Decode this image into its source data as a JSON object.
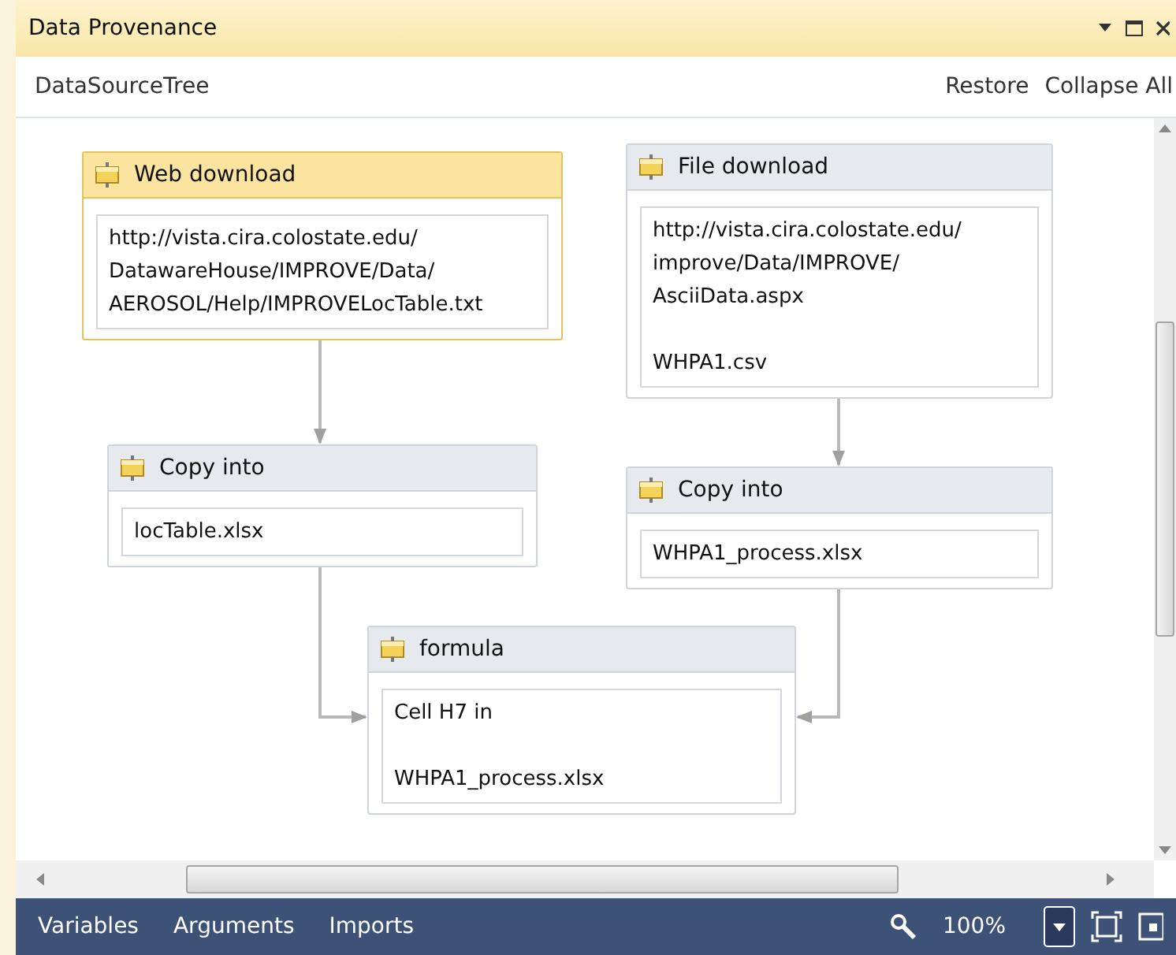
{
  "window": {
    "title": "Data Provenance"
  },
  "toolbar": {
    "title": "DataSourceTree",
    "actions": [
      "Restore",
      "Collapse All"
    ]
  },
  "nodes": [
    {
      "title": "Web download",
      "value": "http://vista.cira.colostate.edu/\nDatawareHouse/IMPROVE/Data/\nAEROSOL/Help/IMPROVELocTable.txt",
      "selected": true
    },
    {
      "title": "File download",
      "value": "http://vista.cira.colostate.edu/\nimprove/Data/IMPROVE/\nAsciiData.aspx\n\nWHPA1.csv",
      "selected": false
    },
    {
      "title": "Copy into",
      "value": "locTable.xlsx",
      "selected": false
    },
    {
      "title": "Copy into",
      "value": "WHPA1_process.xlsx",
      "selected": false
    },
    {
      "title": "formula",
      "value": "Cell H7 in\n\nWHPA1_process.xlsx",
      "selected": false
    }
  ],
  "status_bar": {
    "tabs": [
      "Variables",
      "Arguments",
      "Imports"
    ],
    "zoom": "100%"
  }
}
